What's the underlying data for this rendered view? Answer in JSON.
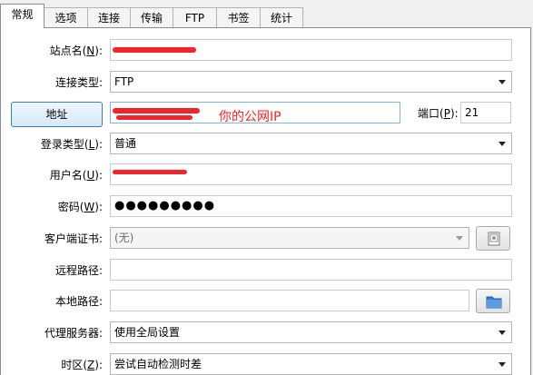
{
  "tabs": [
    {
      "label": "常规",
      "active": true
    },
    {
      "label": "选项"
    },
    {
      "label": "连接"
    },
    {
      "label": "传输"
    },
    {
      "label": "FTP"
    },
    {
      "label": "书签"
    },
    {
      "label": "统计"
    }
  ],
  "form": {
    "site_name": {
      "label_main": "站点名(",
      "key": "N",
      "label_tail": "):",
      "value": ""
    },
    "connection_type": {
      "label": "连接类型:",
      "value": "FTP"
    },
    "address": {
      "button_label": "地址",
      "value": "",
      "annotation": "你的公网IP"
    },
    "port": {
      "label_main": "端口(",
      "key": "P",
      "label_tail": "):",
      "value": "21"
    },
    "login_type": {
      "label_main": "登录类型(",
      "key": "L",
      "label_tail": "):",
      "value": "普通"
    },
    "username": {
      "label_main": "用户名(",
      "key": "U",
      "label_tail": "):",
      "value": ""
    },
    "password": {
      "label_main": "密码(",
      "key": "W",
      "label_tail": "):",
      "value": "●●●●●●●●●"
    },
    "client_cert": {
      "label": "客户端证书:",
      "value": "(无)"
    },
    "remote_path": {
      "label": "远程路径:",
      "value": ""
    },
    "local_path": {
      "label": "本地路径:",
      "value": ""
    },
    "proxy": {
      "label": "代理服务器:",
      "value": "使用全局设置"
    },
    "timezone": {
      "label_main": "时区(",
      "key": "Z",
      "label_tail": "):",
      "value": "尝试自动检测时差"
    }
  },
  "colors": {
    "accent": "#3c7fb1",
    "redaction": "#f2232c",
    "folder": "#3a7fc4"
  }
}
